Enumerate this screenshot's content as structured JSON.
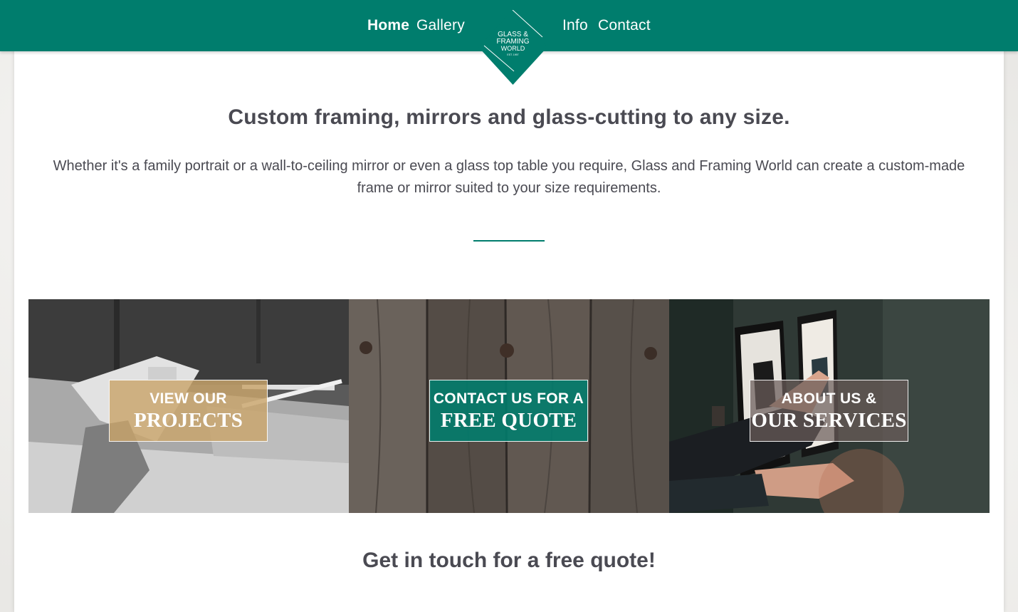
{
  "nav": {
    "home": "Home",
    "gallery": "Gallery",
    "info": "Info",
    "contact": "Contact"
  },
  "logo": {
    "line1": "GLASS &",
    "line2": "FRAMING",
    "line3": "WORLD",
    "line4": "EST. 1997"
  },
  "hero": {
    "headline": "Custom framing, mirrors and glass-cutting to any size.",
    "intro": "Whether it's a family portrait or a wall-to-ceiling mirror or even a glass top table you require, Glass and Framing World can create a custom-made frame or mirror suited to your size requirements."
  },
  "tiles": [
    {
      "small": "VIEW OUR",
      "big": "PROJECTS"
    },
    {
      "small": "CONTACT US FOR A",
      "big": "FREE QUOTE"
    },
    {
      "small": "ABOUT US &",
      "big": "OUR SERVICES"
    }
  ],
  "cta": {
    "heading": "Get in touch for a free quote!"
  },
  "colors": {
    "brand": "#007d6d",
    "text": "#4a4a52",
    "tile_projects": "#c9a56b",
    "tile_quote": "#007d6d",
    "tile_services": "#6b5d5a"
  }
}
